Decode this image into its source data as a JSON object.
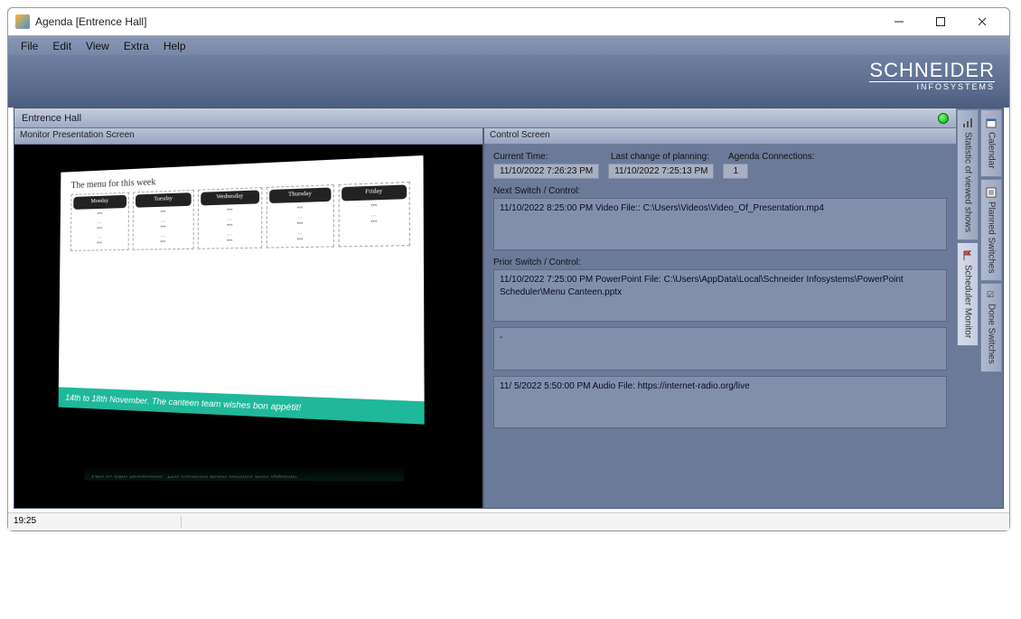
{
  "window": {
    "title": "Agenda [Entrence Hall]"
  },
  "menu": {
    "file": "File",
    "edit": "Edit",
    "view": "View",
    "extra": "Extra",
    "help": "Help"
  },
  "brand": {
    "name": "SCHNEIDER",
    "sub": "INFOSYSTEMS"
  },
  "panel": {
    "location": "Entrence Hall"
  },
  "left": {
    "title": "Monitor Presentation Screen"
  },
  "slide": {
    "heading": "The menu for this week",
    "days": [
      "Monday",
      "Tuesday",
      "Wednesday",
      "Thursday",
      "Friday"
    ],
    "banner": "14th to 18th November. The canteen team wishes bon appétit!"
  },
  "right": {
    "title": "Control Screen",
    "labels": {
      "current": "Current Time:",
      "lastchange": "Last change of planning:",
      "connections": "Agenda Connections:",
      "next": "Next Switch / Control:",
      "prior": "Prior Switch / Control:"
    },
    "values": {
      "current": "11/10/2022 7:26:23 PM",
      "lastchange": "11/10/2022 7:25:13 PM",
      "connections": "1"
    },
    "next_box": "11/10/2022 8:25:00 PM Video File:: C:\\Users\\Videos\\Video_Of_Presentation.mp4",
    "prior_boxes": [
      "11/10/2022 7:25:00 PM PowerPoint File: C:\\Users\\AppData\\Local\\Schneider Infosystems\\PowerPoint Scheduler\\Menu Canteen.pptx",
      "-",
      "11/  5/2022 5:50:00 PM Audio File:  https://internet-radio.org/live"
    ]
  },
  "side": {
    "tabs_col1": [
      "Statistic of viewed shows",
      "Scheduler Monitor"
    ],
    "tabs_col2": [
      "Calendar",
      "Planned Switches",
      "Done Switches"
    ]
  },
  "status": {
    "time": "19:25"
  }
}
